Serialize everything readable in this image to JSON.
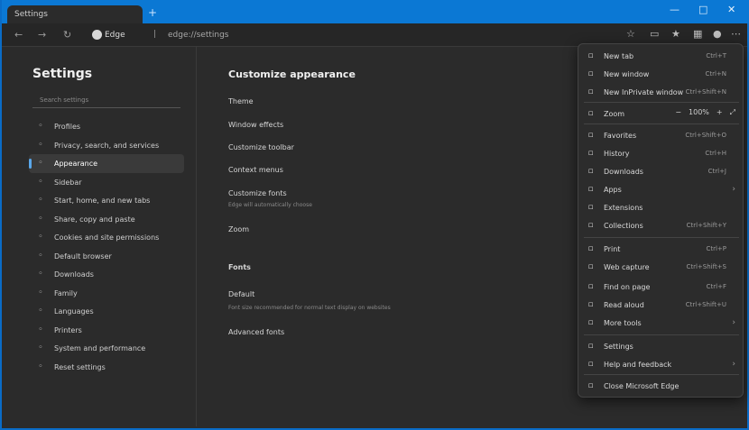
{
  "window": {
    "tab_title": "Settings",
    "new_tab": "+",
    "controls": [
      "—",
      "□",
      "✕"
    ]
  },
  "toolbar": {
    "chip_label": "Edge",
    "address": "edge://settings"
  },
  "sidebar": {
    "title": "Settings",
    "search_placeholder": "Search settings",
    "items": [
      {
        "label": "Profiles",
        "icon": "person-icon"
      },
      {
        "label": "Privacy, search, and services",
        "icon": "lock-icon"
      },
      {
        "label": "Appearance",
        "icon": "palette-icon"
      },
      {
        "label": "Sidebar",
        "icon": "sidebar-icon"
      },
      {
        "label": "Start, home, and new tabs",
        "icon": "home-icon"
      },
      {
        "label": "Share, copy and paste",
        "icon": "share-icon"
      },
      {
        "label": "Cookies and site permissions",
        "icon": "cookie-icon"
      },
      {
        "label": "Default browser",
        "icon": "browser-icon"
      },
      {
        "label": "Downloads",
        "icon": "download-icon"
      },
      {
        "label": "Family",
        "icon": "family-icon"
      },
      {
        "label": "Languages",
        "icon": "language-icon"
      },
      {
        "label": "Printers",
        "icon": "printer-icon"
      },
      {
        "label": "System and performance",
        "icon": "system-icon"
      },
      {
        "label": "Reset settings",
        "icon": "reset-icon"
      }
    ]
  },
  "main": {
    "heading": "Customize appearance",
    "rows": [
      "Theme",
      "Window effects",
      "Customize toolbar",
      "Context menus",
      "Customize fonts",
      "Zoom",
      "Fonts",
      "Default",
      "Advanced fonts"
    ],
    "sub1": "Edge will automatically choose",
    "sub2": "Font size recommended for normal text display on websites"
  },
  "menu": {
    "items": [
      {
        "label": "New tab",
        "shortcut": "Ctrl+T",
        "icon": "tab-icon"
      },
      {
        "label": "New window",
        "shortcut": "Ctrl+N",
        "icon": "window-icon"
      },
      {
        "label": "New InPrivate window",
        "shortcut": "Ctrl+Shift+N",
        "icon": "inprivate-icon"
      },
      {
        "label": "Zoom",
        "icon": "zoom-icon",
        "zoom": {
          "minus": "−",
          "value": "100%",
          "plus": "+",
          "full": "⤢"
        }
      },
      {
        "label": "Favorites",
        "shortcut": "Ctrl+Shift+O",
        "icon": "star-icon"
      },
      {
        "label": "History",
        "shortcut": "Ctrl+H",
        "icon": "history-icon"
      },
      {
        "label": "Downloads",
        "shortcut": "Ctrl+J",
        "icon": "download-icon"
      },
      {
        "label": "Apps",
        "icon": "apps-icon",
        "chev": "›"
      },
      {
        "label": "Extensions",
        "icon": "puzzle-icon"
      },
      {
        "label": "Collections",
        "shortcut": "Ctrl+Shift+Y",
        "icon": "collections-icon"
      },
      {
        "label": "Print",
        "shortcut": "Ctrl+P",
        "icon": "print-icon"
      },
      {
        "label": "Web capture",
        "shortcut": "Ctrl+Shift+S",
        "icon": "capture-icon"
      },
      {
        "label": "Find on page",
        "shortcut": "Ctrl+F",
        "icon": "find-icon"
      },
      {
        "label": "Read aloud",
        "shortcut": "Ctrl+Shift+U",
        "icon": "read-icon"
      },
      {
        "label": "More tools",
        "icon": "tools-icon",
        "chev": "›"
      },
      {
        "label": "Settings",
        "icon": "gear-icon"
      },
      {
        "label": "Help and feedback",
        "icon": "help-icon",
        "chev": "›"
      },
      {
        "label": "Close Microsoft Edge",
        "icon": "close-icon"
      }
    ]
  }
}
